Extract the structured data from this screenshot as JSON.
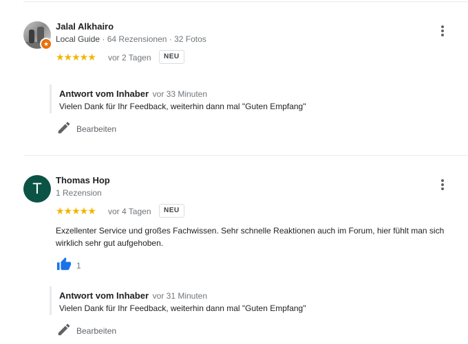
{
  "reviews": [
    {
      "author": "Jalal Alkhairo",
      "guide": "Local Guide",
      "stats": "· 64 Rezensionen · 32 Fotos",
      "rating": 5,
      "stars": "★★★★★",
      "date": "vor 2 Tagen",
      "badge": "NEU",
      "text": "",
      "likes": "",
      "reply": {
        "title": "Antwort vom Inhaber",
        "when": "vor 33 Minuten",
        "text": "Vielen Dank für Ihr Feedback, weiterhin dann mal \"Guten Empfang\""
      },
      "edit_label": "Bearbeiten"
    },
    {
      "author": "Thomas Hop",
      "avatar_letter": "T",
      "stats": "1 Rezension",
      "rating": 5,
      "stars": "★★★★★",
      "date": "vor 4 Tagen",
      "badge": "NEU",
      "text": "Exzellenter Service und großes Fachwissen. Sehr schnelle Reaktionen auch im Forum, hier fühlt man sich wirklich sehr gut aufgehoben.",
      "likes": "1",
      "reply": {
        "title": "Antwort vom Inhaber",
        "when": "vor 31 Minuten",
        "text": "Vielen Dank für Ihr Feedback, weiterhin dann mal \"Guten Empfang\""
      },
      "edit_label": "Bearbeiten"
    }
  ],
  "colors": {
    "star": "#f4b400",
    "like_blue": "#1a73e8",
    "avatar_green": "#0b5345",
    "guide_orange": "#e8710a"
  },
  "icons": [
    "more-vert-icon",
    "thumb-up-icon",
    "edit-pencil-icon",
    "local-guide-badge-icon"
  ]
}
